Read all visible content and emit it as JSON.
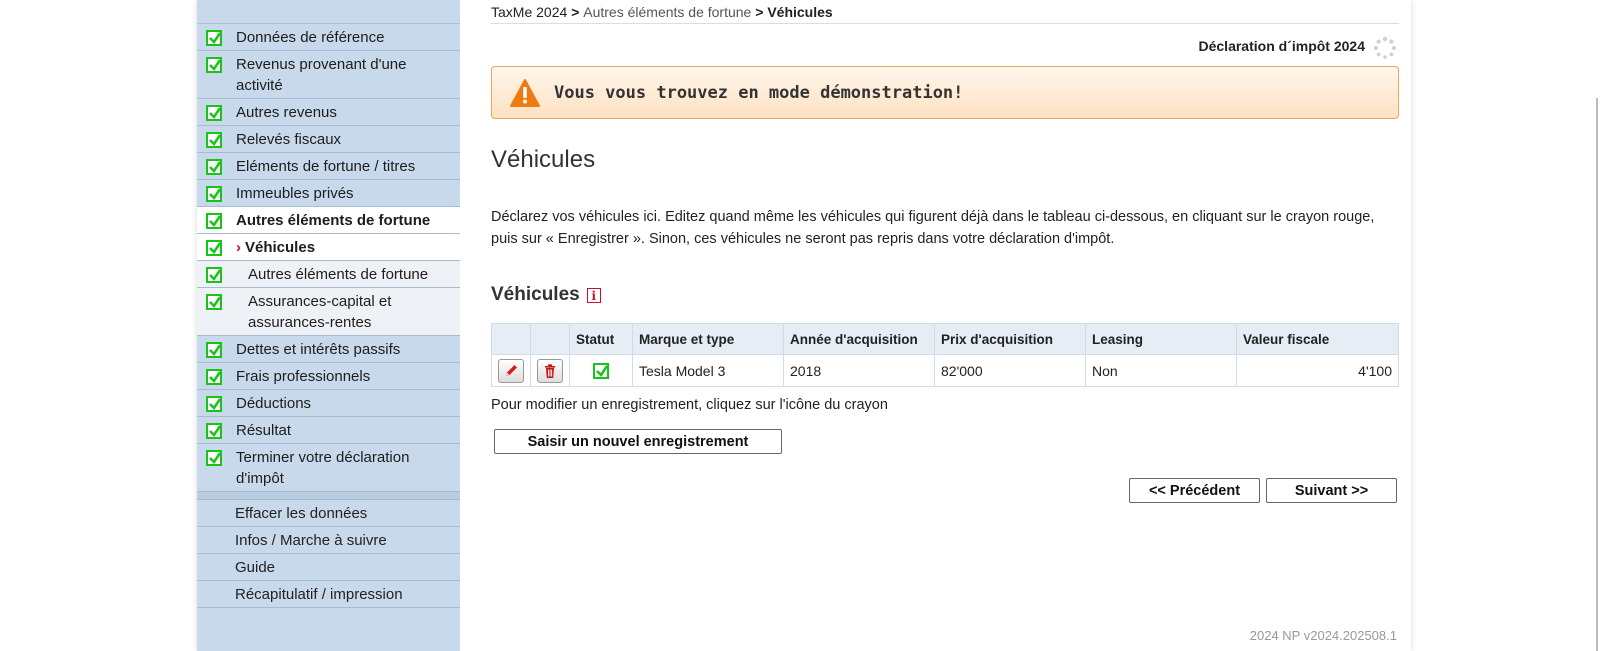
{
  "sidebar": {
    "items": [
      {
        "label": "Données de référence"
      },
      {
        "label": "Revenus provenant d'une activité"
      },
      {
        "label": "Autres revenus"
      },
      {
        "label": "Relevés fiscaux"
      },
      {
        "label": "Eléments de fortune / titres"
      },
      {
        "label": "Immeubles privés"
      },
      {
        "label": "Autres éléments de fortune"
      },
      {
        "label": "Véhicules"
      },
      {
        "label": "Autres éléments de fortune"
      },
      {
        "label": "Assurances-capital et assurances-rentes"
      },
      {
        "label": "Dettes et intérêts passifs"
      },
      {
        "label": "Frais professionnels"
      },
      {
        "label": "Déductions"
      },
      {
        "label": "Résultat"
      },
      {
        "label": "Terminer votre déclaration d'impôt"
      }
    ],
    "links": [
      {
        "label": "Effacer les données"
      },
      {
        "label": "Infos / Marche à suivre"
      },
      {
        "label": "Guide"
      },
      {
        "label": "Récapitulatif / impression"
      }
    ],
    "current_marker": "›"
  },
  "breadcrumb": {
    "root": "TaxMe 2024",
    "sep1": " > ",
    "middle": "Autres éléments de fortune",
    "sep2": " > ",
    "current": "Véhicules"
  },
  "header": {
    "declaration": "Déclaration d´impôt 2024"
  },
  "demo_banner": {
    "text": "Vous vous trouvez en mode démonstration!",
    "color": "#f0a45a"
  },
  "page": {
    "title": "Véhicules",
    "intro": "Déclarez vos véhicules ici. Editez quand même les véhicules qui figurent déjà dans le tableau ci-dessous, en cliquant sur le crayon rouge, puis sur « Enregistrer ». Sinon, ces véhicules ne seront pas repris dans votre déclaration d'impôt.",
    "section_title": "Véhicules",
    "info_icon": "i",
    "hint": "Pour modifier un enregistrement, cliquez sur l'icône du crayon",
    "new_button": "Saisir un nouvel enregistrement",
    "prev_button": "<< Précédent",
    "next_button": "Suivant >>",
    "version": "2024 NP v2024.202508.1"
  },
  "table": {
    "headers": [
      "",
      "",
      "Statut",
      "Marque et type",
      "Année d'acquisition",
      "Prix d'acquisition",
      "Leasing",
      "Valeur fiscale"
    ],
    "rows": [
      {
        "marque": "Tesla Model 3",
        "annee": "2018",
        "prix": "82'000",
        "leasing": "Non",
        "valeur": "4'100"
      }
    ]
  },
  "icons": {
    "check": "check-icon",
    "edit": "pencil-icon",
    "delete": "trash-icon",
    "warning": "warning-icon",
    "spinner": "spinner-icon"
  }
}
